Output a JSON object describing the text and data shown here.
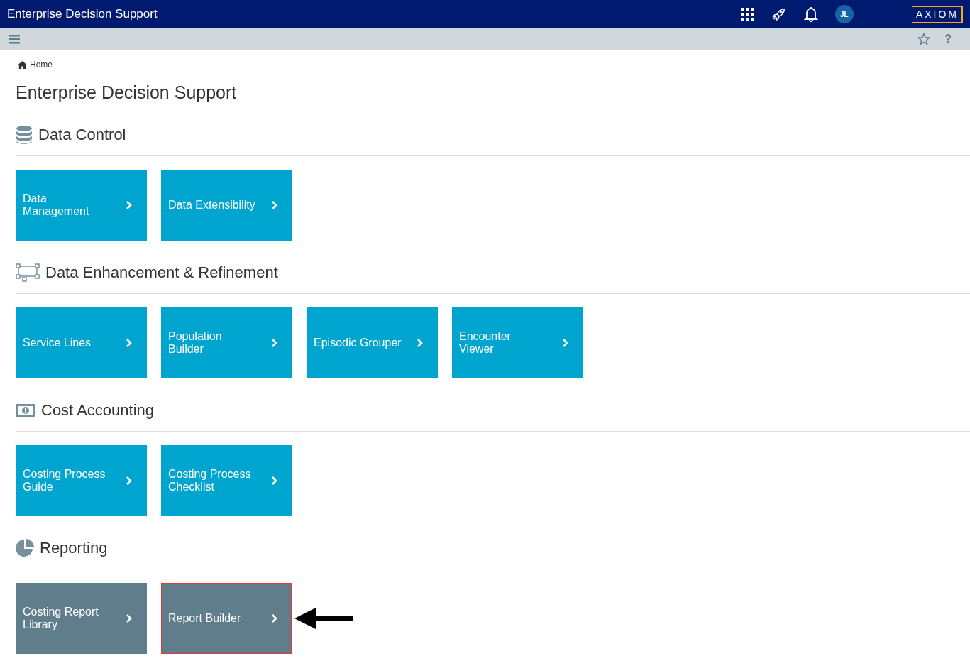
{
  "top_bar": {
    "title": "Enterprise Decision Support",
    "avatar": "JL",
    "logo": "AXIOM"
  },
  "help": "?",
  "breadcrumb": "Home",
  "page_title": "Enterprise Decision Support",
  "sections": [
    {
      "title": "Data Control",
      "kind": "database",
      "tiles": [
        {
          "lines": [
            "Data",
            "Management"
          ],
          "color": "#00a5cf",
          "highlighted": false
        },
        {
          "lines": [
            "Data Extensibility"
          ],
          "color": "#00a5cf",
          "highlighted": false
        }
      ]
    },
    {
      "title": "Data Enhancement & Refinement",
      "kind": "nodes",
      "tiles": [
        {
          "lines": [
            "Service Lines"
          ],
          "color": "#00a5cf",
          "highlighted": false
        },
        {
          "lines": [
            "Population",
            "Builder"
          ],
          "color": "#00a5cf",
          "highlighted": false
        },
        {
          "lines": [
            "Episodic Grouper"
          ],
          "color": "#00a5cf",
          "highlighted": false
        },
        {
          "lines": [
            "Encounter",
            "Viewer"
          ],
          "color": "#00a5cf",
          "highlighted": false
        }
      ]
    },
    {
      "title": "Cost Accounting",
      "kind": "money",
      "tiles": [
        {
          "lines": [
            "Costing Process",
            "Guide"
          ],
          "color": "#00a5cf",
          "highlighted": false
        },
        {
          "lines": [
            "Costing Process",
            "Checklist"
          ],
          "color": "#00a5cf",
          "highlighted": false
        }
      ]
    },
    {
      "title": "Reporting",
      "kind": "pie",
      "tiles": [
        {
          "lines": [
            "Costing Report",
            "Library"
          ],
          "color": "#607d8b",
          "highlighted": false
        },
        {
          "lines": [
            "Report Builder"
          ],
          "color": "#607d8b",
          "highlighted": true
        }
      ]
    }
  ]
}
